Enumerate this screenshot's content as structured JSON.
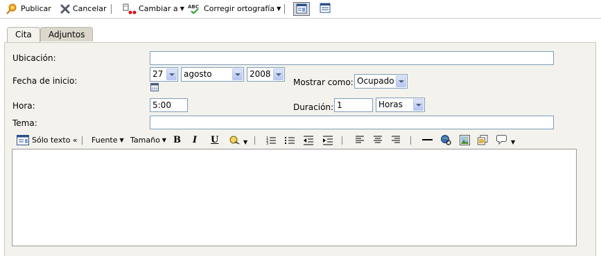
{
  "toolbar": {
    "publish_label": "Publicar",
    "cancel_label": "Cancelar",
    "change_to_label": "Cambiar a",
    "spellcheck_label": "Corregir ortografía"
  },
  "tabs": [
    {
      "label": "Cita",
      "active": true
    },
    {
      "label": "Adjuntos",
      "active": false
    }
  ],
  "form": {
    "location_label": "Ubicación:",
    "location_value": "",
    "start_date_label": "Fecha de inicio:",
    "day_value": "27",
    "month_value": "agosto",
    "year_value": "2008",
    "show_as_label": "Mostrar como:",
    "show_as_value": "Ocupado",
    "time_label": "Hora:",
    "time_value": "5:00",
    "duration_label": "Duración:",
    "duration_value": "1",
    "duration_unit_value": "Horas",
    "subject_label": "Tema:",
    "subject_value": ""
  },
  "editor": {
    "plain_text_label": "Sólo texto «",
    "font_label": "Fuente",
    "size_label": "Tamaño",
    "bold_label": "B",
    "italic_label": "I",
    "underline_label": "U",
    "body_value": ""
  },
  "colors": {
    "panel_bg": "#f3f2ec",
    "tab_inactive_bg": "#dbd8cb",
    "input_border": "#7f9db9"
  }
}
